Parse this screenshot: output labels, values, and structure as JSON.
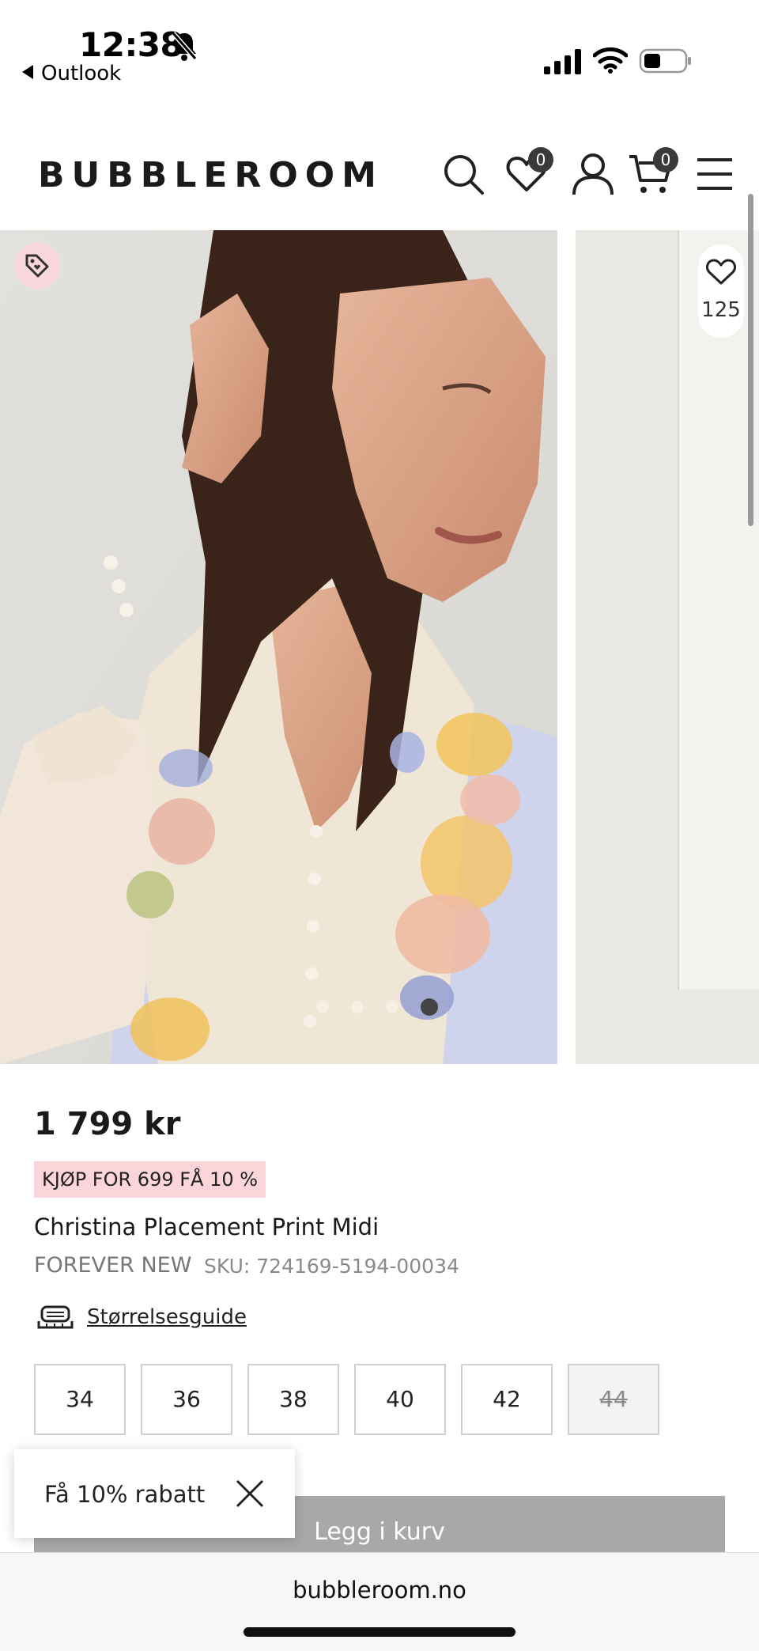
{
  "status_bar": {
    "time": "12:38",
    "back_app": "Outlook",
    "icons": [
      "bell-slash-icon",
      "signal-icon",
      "wifi-icon",
      "battery-icon"
    ]
  },
  "header": {
    "logo": "BUBBLEROOM",
    "wishlist_count": "0",
    "cart_count": "0",
    "icons": [
      "search-icon",
      "heart-icon",
      "account-icon",
      "cart-icon",
      "menu-icon"
    ]
  },
  "gallery": {
    "favorites_count": "125",
    "slide_count": 4,
    "active_slide": 4,
    "icons": [
      "tag-icon",
      "heart-icon"
    ]
  },
  "product": {
    "price": "1 799 kr",
    "promo": "KJØP FOR 699 FÅ 10 %",
    "title": "Christina Placement Print Midi",
    "brand": "FOREVER NEW",
    "sku": "SKU: 724169-5194-00034",
    "size_guide": "Størrelsesguide",
    "sizes": [
      {
        "label": "34",
        "available": true
      },
      {
        "label": "36",
        "available": true
      },
      {
        "label": "38",
        "available": true
      },
      {
        "label": "40",
        "available": true
      },
      {
        "label": "42",
        "available": true
      },
      {
        "label": "44",
        "available": false
      }
    ],
    "add_to_cart": "Legg i kurv"
  },
  "popup": {
    "text": "Få 10% rabatt"
  },
  "browser": {
    "url": "bubbleroom.no"
  },
  "colors": {
    "promo_bg": "#fbd5da",
    "button_disabled": "#a8a8a8",
    "badge": "#3a3a3a"
  }
}
